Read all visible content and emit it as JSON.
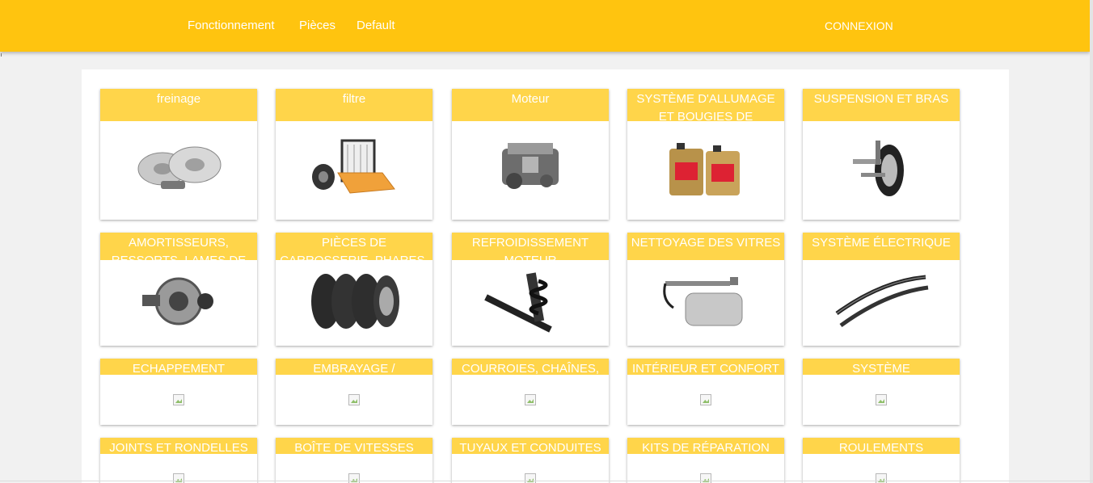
{
  "nav": {
    "links": [
      "Fonctionnement",
      "Pièces",
      "Default"
    ],
    "login": "CONNEXION"
  },
  "categories": [
    {
      "title": "freinage",
      "icon": "brake-discs-icon"
    },
    {
      "title": "filtre",
      "icon": "filters-icon"
    },
    {
      "title": "Moteur",
      "icon": "engine-icon"
    },
    {
      "title": "SYSTÈME D'ALLUMAGE ET BOUGIES DE",
      "icon": "oil-cans-icon"
    },
    {
      "title": "SUSPENSION ET BRAS",
      "icon": "wheel-suspension-icon"
    },
    {
      "title": "AMORTISSEURS, RESSORTS, LAMES DE RESSORTS",
      "icon": "alternator-icon"
    },
    {
      "title": "PIÈCES DE CARROSSERIE, PHARES, RÉTROVISEURS",
      "icon": "tires-icon"
    },
    {
      "title": "REFROIDISSEMENT MOTEUR",
      "icon": "shock-absorber-icon"
    },
    {
      "title": "NETTOYAGE DES VITRES",
      "icon": "fuel-tank-icon"
    },
    {
      "title": "SYSTÈME ÉLECTRIQUE",
      "icon": "wiper-blades-icon"
    },
    {
      "title": "ECHAPPEMENT",
      "icon": "broken-image-icon"
    },
    {
      "title": "EMBRAYAGE /",
      "icon": "broken-image-icon"
    },
    {
      "title": "COURROIES, CHAÎNES,",
      "icon": "broken-image-icon"
    },
    {
      "title": "INTÉRIEUR ET CONFORT",
      "icon": "broken-image-icon"
    },
    {
      "title": "SYSTÈME D'ALIMENTATION",
      "icon": "broken-image-icon"
    },
    {
      "title": "JOINTS ET RONDELLES",
      "icon": "broken-image-icon"
    },
    {
      "title": "BOÎTE DE VITESSES",
      "icon": "broken-image-icon"
    },
    {
      "title": "TUYAUX ET CONDUITES",
      "icon": "broken-image-icon"
    },
    {
      "title": "KITS DE RÉPARATION",
      "icon": "broken-image-icon"
    },
    {
      "title": "ROULEMENTS",
      "icon": "broken-image-icon"
    }
  ],
  "colors": {
    "nav_bg": "#ffc40f",
    "card_header": "#ffd54a",
    "text": "#ffffff"
  }
}
